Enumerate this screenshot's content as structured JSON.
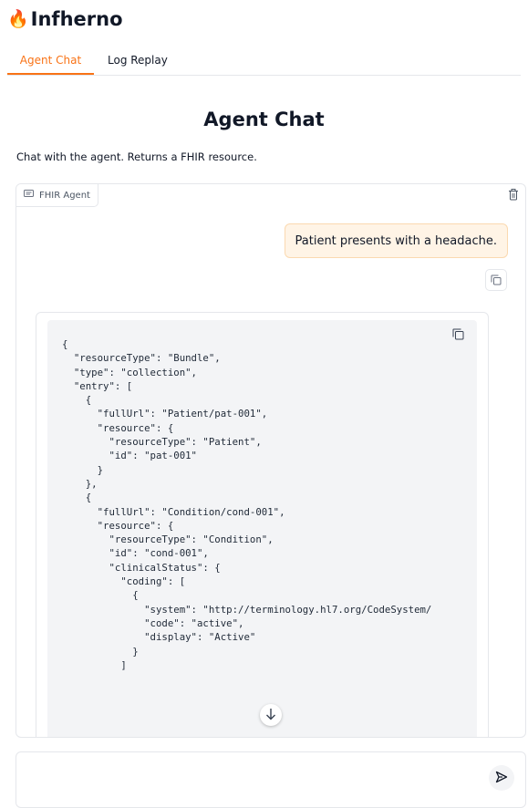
{
  "app": {
    "title": "Infherno",
    "logo_icon": "flame-icon"
  },
  "tabs": [
    {
      "label": "Agent Chat",
      "active": true
    },
    {
      "label": "Log Replay",
      "active": false
    }
  ],
  "page": {
    "title": "Agent Chat",
    "description": "Chat with the agent. Returns a FHIR resource."
  },
  "chat": {
    "label": "FHIR Agent",
    "label_icon": "chat-icon",
    "messages": [
      {
        "role": "user",
        "text": "Patient presents with a headache."
      },
      {
        "role": "assistant",
        "code": "{\n  \"resourceType\": \"Bundle\",\n  \"type\": \"collection\",\n  \"entry\": [\n    {\n      \"fullUrl\": \"Patient/pat-001\",\n      \"resource\": {\n        \"resourceType\": \"Patient\",\n        \"id\": \"pat-001\"\n      }\n    },\n    {\n      \"fullUrl\": \"Condition/cond-001\",\n      \"resource\": {\n        \"resourceType\": \"Condition\",\n        \"id\": \"cond-001\",\n        \"clinicalStatus\": {\n          \"coding\": [\n            {\n              \"system\": \"http://terminology.hl7.org/CodeSystem/\n              \"code\": \"active\",\n              \"display\": \"Active\"\n            }\n          ]"
      }
    ]
  },
  "input": {
    "value": "",
    "placeholder": ""
  },
  "colors": {
    "accent": "#f97316",
    "user_bubble_bg": "#fff4e6",
    "user_bubble_border": "#fbd9b0",
    "code_bg": "#f3f4f6"
  }
}
